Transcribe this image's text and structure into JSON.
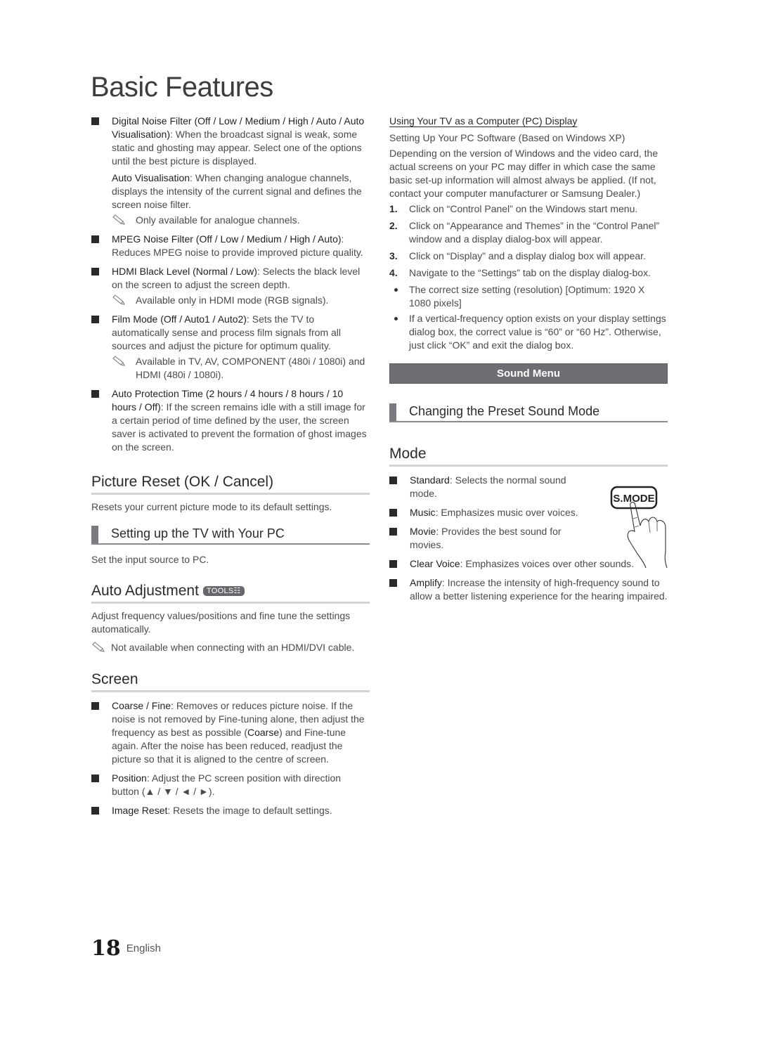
{
  "page": {
    "title": "Basic Features",
    "page_number": "18",
    "language": "English"
  },
  "left": {
    "items": [
      {
        "label": "Digital Noise Filter (Off / Low / Medium / High / Auto / Auto Visualisation)",
        "text": ": When the broadcast signal is weak, some static and ghosting may appear. Select one of the options until the best picture is displayed."
      },
      {
        "label": "MPEG Noise Filter (Off / Low / Medium / High / Auto)",
        "text": ": Reduces MPEG noise to provide improved picture quality."
      },
      {
        "label": "HDMI Black Level (Normal / Low)",
        "text": ": Selects the black level on the screen to adjust the screen depth."
      },
      {
        "label": "Film Mode (Off / Auto1 / Auto2)",
        "text": ": Sets the TV to automatically sense and process film signals from all sources and adjust the picture for optimum quality."
      },
      {
        "label": "Auto Protection Time (2 hours / 4 hours / 8 hours / 10 hours / Off)",
        "text": ":  If the screen remains idle with a still image for a certain period of time defined by the user, the screen saver is activated to prevent the formation of ghost images on the screen."
      }
    ],
    "auto_vis": {
      "label": "Auto Visualisation",
      "text": ": When changing analogue channels, displays the intensity of the current signal and defines the screen noise filter."
    },
    "notes": {
      "analogue": "Only available for analogue channels.",
      "hdmi": "Available only in HDMI mode (RGB signals).",
      "film": "Available in TV, AV, COMPONENT (480i / 1080i) and HDMI (480i / 1080i)."
    },
    "picture_reset": {
      "heading": "Picture Reset (OK / Cancel)",
      "text": "Resets your current picture mode to its default settings."
    },
    "setup_pc": {
      "heading": "Setting up the TV with Your PC",
      "text": "Set the input source to PC."
    },
    "auto_adjust": {
      "heading": "Auto Adjustment",
      "badge": "TOOLS☷",
      "text": "Adjust frequency values/positions and fine tune the settings automatically.",
      "note": "Not available when connecting with an HDMI/DVI cable."
    },
    "screen": {
      "heading": "Screen",
      "coarse_label": "Coarse / Fine",
      "coarse_text_1": ": Removes or reduces picture noise. If the noise is not removed by Fine-tuning alone, then adjust the frequency as best as possible (",
      "coarse_bold": "Coarse",
      "coarse_text_2": ") and Fine-tune again. After the noise has been reduced, readjust the picture so that it is aligned to the centre of screen.",
      "position_label": "Position",
      "position_text": ": Adjust the PC screen position with direction button (▲ / ▼ / ◄ / ►).",
      "reset_label": "Image Reset",
      "reset_text": ": Resets the image to default settings."
    }
  },
  "right": {
    "pc_display": {
      "title": "Using Your TV as a Computer (PC) Display",
      "subtitle": "Setting Up Your PC Software (Based on Windows XP)",
      "intro": "Depending on the version of Windows and the video card, the actual screens on your PC may differ in which case the same basic set-up information will almost always be applied. (If not, contact your computer manufacturer or Samsung Dealer.)",
      "steps": [
        {
          "n": "1.",
          "text": "Click on “Control Panel” on the Windows start menu."
        },
        {
          "n": "2.",
          "text": "Click on “Appearance and Themes” in the “Control Panel” window and a display dialog-box will appear."
        },
        {
          "n": "3.",
          "text": "Click on “Display” and a display dialog box will appear."
        },
        {
          "n": "4.",
          "text": "Navigate to the “Settings” tab on the display dialog-box."
        }
      ],
      "bullets": [
        "The correct size setting (resolution) [Optimum: 1920 X 1080 pixels]",
        "If a vertical-frequency option exists on your display settings dialog box, the correct value is “60” or “60 Hz”. Otherwise, just click “OK” and exit the dialog box."
      ]
    },
    "sound_menu": "Sound Menu",
    "preset_heading": "Changing the Preset Sound Mode",
    "mode": {
      "heading": "Mode",
      "button_label": "S.MODE",
      "items": [
        {
          "label": "Standard",
          "text": ": Selects the normal sound mode."
        },
        {
          "label": "Music",
          "text": ": Emphasizes music over voices."
        },
        {
          "label": "Movie",
          "text": ": Provides the best sound for movies."
        },
        {
          "label": "Clear Voice",
          "text": ": Emphasizes voices over other sounds."
        },
        {
          "label": "Amplify",
          "text": ": Increase the intensity of high-frequency sound to allow a better listening experience for the hearing impaired."
        }
      ]
    }
  }
}
